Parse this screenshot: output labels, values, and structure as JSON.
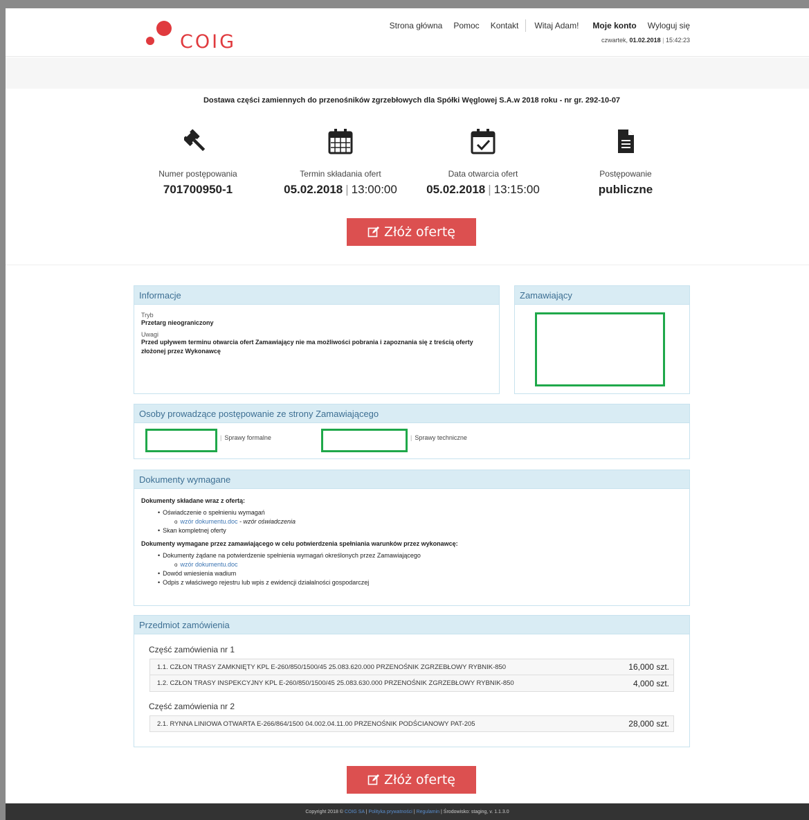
{
  "brand": {
    "name": "COIG",
    "primary": "#e03a3e",
    "cta": "#dc5050",
    "panel_head": "#d9ecf4",
    "panel_text": "#3d6f93"
  },
  "nav": {
    "home": "Strona główna",
    "help": "Pomoc",
    "contact": "Kontakt",
    "greeting": "Witaj Adam!",
    "account": "Moje konto",
    "logout": "Wyloguj się"
  },
  "datetime": {
    "day": "czwartek,",
    "date": "01.02.2018",
    "sep": "|",
    "time": "15:42:23"
  },
  "title": "Dostawa części zamiennych do przenośników zgrzebłowych dla Spółki Węglowej S.A.w 2018 roku - nr gr. 292-10-07",
  "stats": {
    "number": {
      "label": "Numer postępowania",
      "value": "701700950-1",
      "icon": "gavel-icon"
    },
    "deadline": {
      "label": "Termin składania ofert",
      "date": "05.02.2018",
      "sep": "|",
      "time": "13:00:00",
      "icon": "calendar-icon"
    },
    "opening": {
      "label": "Data otwarcia ofert",
      "date": "05.02.2018",
      "sep": "|",
      "time": "13:15:00",
      "icon": "calendar-check-icon"
    },
    "procedure": {
      "label": "Postępowanie",
      "value": "publiczne",
      "icon": "document-icon"
    }
  },
  "cta": {
    "label": "Złóż ofertę",
    "icon": "edit-icon"
  },
  "info": {
    "title": "Informacje",
    "mode_label": "Tryb",
    "mode_value": "Przetarg nieograniczony",
    "notes_label": "Uwagi",
    "notes_value": "Przed upływem terminu otwarcia ofert Zamawiający nie ma możliwości pobrania i zapoznania się z treścią oferty złożonej przez Wykonawcę"
  },
  "buyer": {
    "title": "Zamawiający"
  },
  "persons": {
    "title": "Osoby prowadzące postępowanie ze strony Zamawiającego",
    "sep": "|",
    "formal": "Sprawy formalne",
    "technical": "Sprawy techniczne"
  },
  "documents": {
    "title": "Dokumenty wymagane",
    "group1_title": "Dokumenty składane wraz z ofertą:",
    "g1_item1": "Oświadczenie o spełnieniu wymagań",
    "g1_item1_link": "wzór dokumentu.doc",
    "g1_item1_note": " - wzór oświadczenia",
    "g1_item2": "Skan kompletnej oferty",
    "group2_title": "Dokumenty wymagane przez zamawiającego w celu potwierdzenia spełniania warunków przez wykonawcę:",
    "g2_item1": "Dokumenty żądane na potwierdzenie spełnienia wymagań określonych przez Zamawiającego",
    "g2_item1_link": "wzór dokumentu.doc",
    "g2_item2": "Dowód wniesienia wadium",
    "g2_item3": "Odpis z właściwego rejestru lub wpis z ewidencji działalności gospodarczej"
  },
  "order": {
    "title": "Przedmiot zamówienia",
    "part1_title": "Część zamówienia nr 1",
    "part1_items": [
      {
        "name": "1.1. CZŁON TRASY ZAMKNIĘTY KPL E-260/850/1500/45 25.083.620.000 PRZENOŚNIK ZGRZEBŁOWY RYBNIK-850",
        "qty": "16,000 szt."
      },
      {
        "name": "1.2. CZŁON TRASY INSPEKCYJNY KPL E-260/850/1500/45 25.083.630.000 PRZENOŚNIK ZGRZEBŁOWY RYBNIK-850",
        "qty": "4,000 szt."
      }
    ],
    "part2_title": "Część zamówienia nr 2",
    "part2_items": [
      {
        "name": "2.1. RYNNA LINIOWA OTWARTA E-266/864/1500 04.002.04.11.00 PRZENOŚNIK PODŚCIANOWY PAT-205",
        "qty": "28,000 szt."
      }
    ]
  },
  "footer": {
    "copyright": "Copyright 2018 ©",
    "company": "COIG SA",
    "sep": "|",
    "privacy": "Polityka prywatności",
    "terms": "Regulamin",
    "env": "Środowisko: staging, v. 1.1.3.0"
  }
}
